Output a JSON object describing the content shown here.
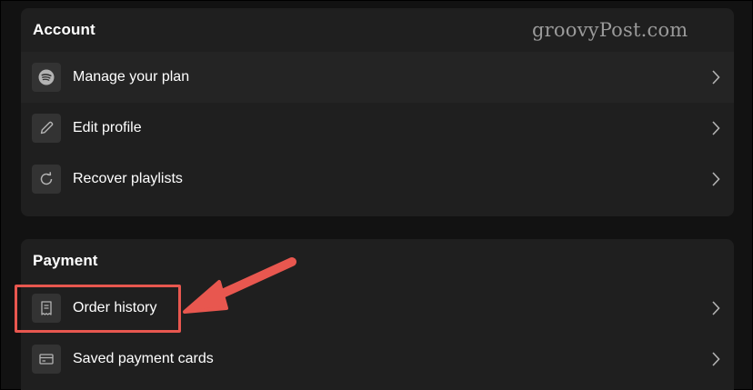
{
  "watermark": "groovyPost.com",
  "account": {
    "title": "Account",
    "items": [
      {
        "label": "Manage your plan",
        "icon": "spotify-icon"
      },
      {
        "label": "Edit profile",
        "icon": "pencil-icon"
      },
      {
        "label": "Recover playlists",
        "icon": "refresh-icon"
      }
    ]
  },
  "payment": {
    "title": "Payment",
    "items": [
      {
        "label": "Order history",
        "icon": "receipt-icon"
      },
      {
        "label": "Saved payment cards",
        "icon": "credit-card-icon"
      }
    ]
  },
  "colors": {
    "background": "#121212",
    "card": "#1f1f1f",
    "active_row": "#242424",
    "icon_tile": "#333333",
    "text": "#ffffff",
    "annotation": "#e8574f"
  }
}
